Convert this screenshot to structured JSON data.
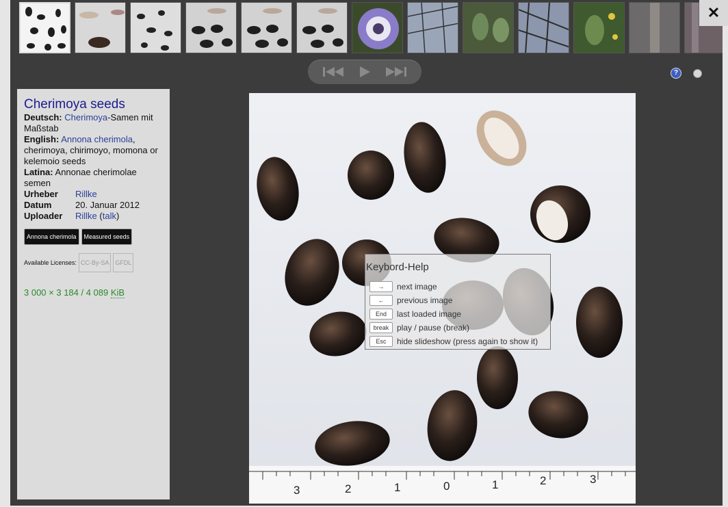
{
  "toolbar": {
    "close_glyph": "✕",
    "help_glyph": "?"
  },
  "thumbnails": [
    {
      "icon": "seeds-white-thumbnail"
    },
    {
      "icon": "seeds-opened-thumbnail"
    },
    {
      "icon": "seeds-scattered-thumbnail"
    },
    {
      "icon": "seeds-ruler-thumbnail"
    },
    {
      "icon": "seeds-ruler-thumbnail-2"
    },
    {
      "icon": "seeds-ruler-thumbnail-3"
    },
    {
      "icon": "passion-flower-thumbnail"
    },
    {
      "icon": "greenhouse-thumbnail"
    },
    {
      "icon": "cactus-thumbnail"
    },
    {
      "icon": "greenhouse-roof-thumbnail"
    },
    {
      "icon": "cactus-flowers-thumbnail"
    },
    {
      "icon": "tree-thumbnail"
    },
    {
      "icon": "tree-thumbnail-2"
    }
  ],
  "info": {
    "title": "Cherimoya seeds",
    "deutsch_label": "Deutsch:",
    "deutsch_link": "Cherimoya",
    "deutsch_text": "-Samen mit Maßstab",
    "english_label": "English:",
    "english_link": "Annona cherimola",
    "english_text": ", cherimoya, chirimoyo, momona or kelemoio seeds",
    "latina_label": "Latina:",
    "latina_text": "Annonae cherimolae semen",
    "urheber_label": "Urheber",
    "urheber_value": "Rillke",
    "datum_label": "Datum",
    "datum_value": "20. Januar 2012",
    "uploader_label": "Uploader",
    "uploader_value": "Rillke",
    "uploader_talk": "talk",
    "categories": [
      "Annona cherimola",
      "Measured seeds"
    ],
    "licenses_label": "Available Licenses:",
    "licenses": [
      "CC-By-SA",
      "GFDL"
    ],
    "size_prefix": "3 000 × 3 184 / 4 089 ",
    "size_unit": "KiB"
  },
  "keyboard_help": {
    "title": "Keybord-Help",
    "items": [
      {
        "key": "→",
        "desc": "next image"
      },
      {
        "key": "←",
        "desc": "previous image"
      },
      {
        "key": "End",
        "desc": "last loaded image"
      },
      {
        "key": "break",
        "desc": "play / pause (break)"
      },
      {
        "key": "Esc",
        "desc": "hide slideshow (press again to show it)"
      }
    ]
  },
  "ruler_labels": [
    "3",
    "2",
    "1",
    "0",
    "1",
    "2",
    "3"
  ]
}
